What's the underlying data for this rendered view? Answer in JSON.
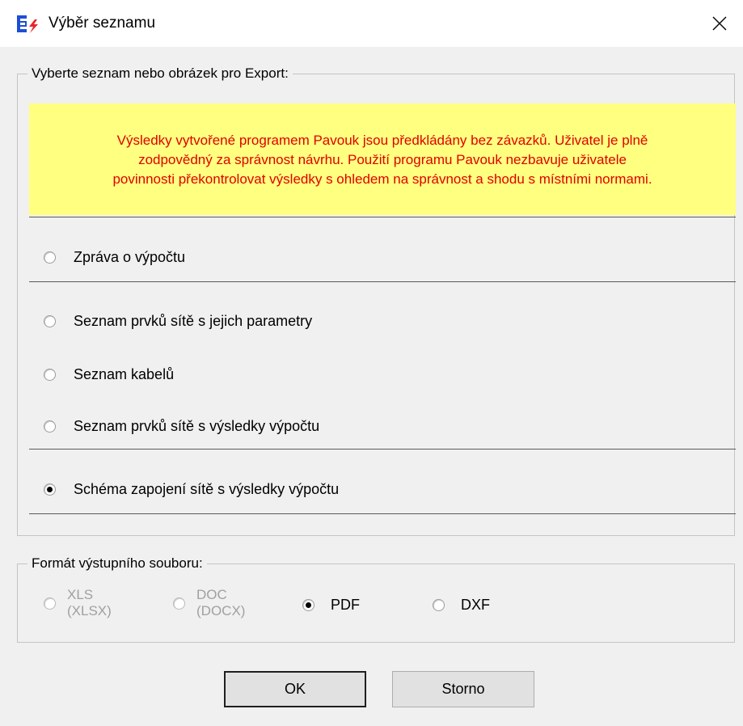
{
  "window": {
    "title": "Výběr seznamu",
    "app_icon": "app-logo-icon",
    "close_icon": "close-icon"
  },
  "list_group": {
    "legend": "Vyberte seznam nebo obrázek pro Export:",
    "warning_lines": [
      "Výsledky vytvořené programem Pavouk jsou předkládány bez závazků. Uživatel je plně",
      "zodpovědný za správnost návrhu. Použití programu Pavouk nezbavuje uživatele",
      "povinnosti překontrolovat výsledky s ohledem na správnost a shodu s místními normami."
    ],
    "options": [
      {
        "label": "Zpráva o výpočtu",
        "checked": false
      },
      {
        "label": "Seznam prvků sítě s jejich parametry",
        "checked": false
      },
      {
        "label": "Seznam kabelů",
        "checked": false
      },
      {
        "label": "Seznam prvků sítě s výsledky výpočtu",
        "checked": false
      },
      {
        "label": "Schéma zapojení sítě s výsledky výpočtu",
        "checked": true
      }
    ]
  },
  "format_group": {
    "legend": "Formát výstupního souboru:",
    "options": [
      {
        "line1": "XLS",
        "line2": "(XLSX)",
        "checked": false,
        "disabled": true
      },
      {
        "line1": "DOC",
        "line2": "(DOCX)",
        "checked": false,
        "disabled": true
      },
      {
        "label": "PDF",
        "checked": true,
        "disabled": false
      },
      {
        "label": "DXF",
        "checked": false,
        "disabled": false
      }
    ]
  },
  "buttons": {
    "ok": "OK",
    "cancel": "Storno"
  },
  "colors": {
    "warning_bg": "#ffff80",
    "warning_text": "#e00000",
    "accent_blue": "#1e4ed8",
    "accent_red": "#e8262a"
  }
}
